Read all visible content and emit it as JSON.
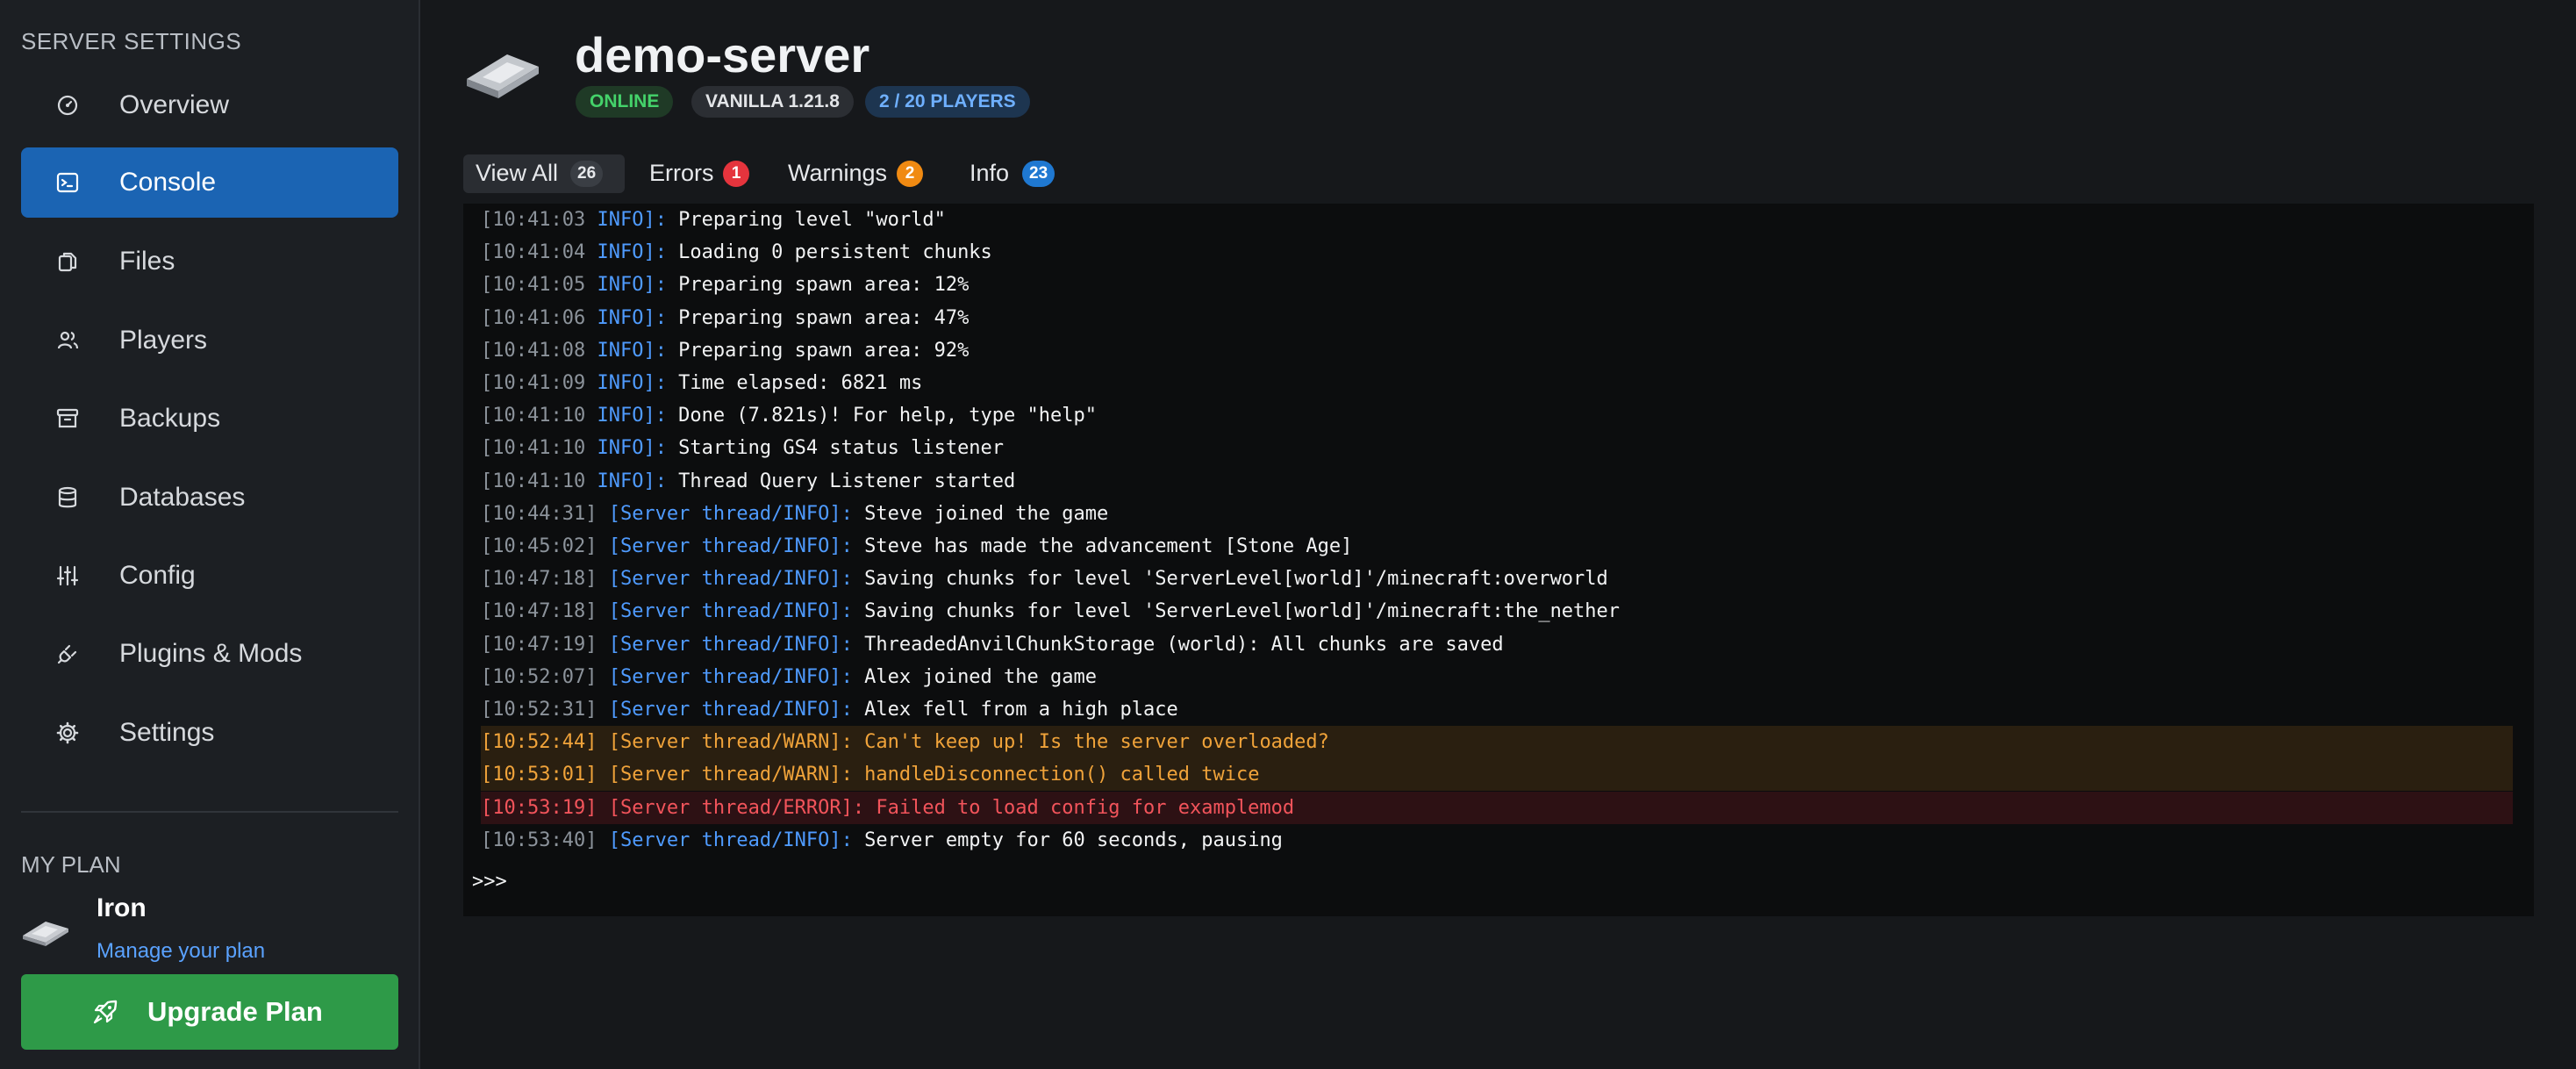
{
  "sidebar": {
    "title": "SERVER SETTINGS",
    "items": [
      {
        "label": "Overview",
        "icon": "gauge-icon"
      },
      {
        "label": "Console",
        "icon": "terminal-icon",
        "active": true
      },
      {
        "label": "Files",
        "icon": "files-icon"
      },
      {
        "label": "Players",
        "icon": "users-icon"
      },
      {
        "label": "Backups",
        "icon": "archive-icon"
      },
      {
        "label": "Databases",
        "icon": "database-icon"
      },
      {
        "label": "Config",
        "icon": "sliders-icon"
      },
      {
        "label": "Plugins & Mods",
        "icon": "plug-icon"
      },
      {
        "label": "Settings",
        "icon": "gear-icon"
      }
    ],
    "plan": {
      "title": "MY PLAN",
      "name": "Iron",
      "manage_label": "Manage your plan",
      "upgrade_label": "Upgrade Plan"
    }
  },
  "header": {
    "server_name": "demo-server",
    "status": "ONLINE",
    "version": "VANILLA 1.21.8",
    "players": "2 / 20 PLAYERS"
  },
  "tabs": [
    {
      "label": "View All",
      "count": "26"
    },
    {
      "label": "Errors",
      "count": "1"
    },
    {
      "label": "Warnings",
      "count": "2"
    },
    {
      "label": "Info",
      "count": "23"
    }
  ],
  "console": {
    "lines": [
      {
        "ts": "[10:41:03",
        "src": " INFO]:",
        "msg": " Preparing level \"world\"",
        "level": "info"
      },
      {
        "ts": "[10:41:04",
        "src": " INFO]:",
        "msg": " Loading 0 persistent chunks",
        "level": "info"
      },
      {
        "ts": "[10:41:05",
        "src": " INFO]:",
        "msg": " Preparing spawn area: 12%",
        "level": "info"
      },
      {
        "ts": "[10:41:06",
        "src": " INFO]:",
        "msg": " Preparing spawn area: 47%",
        "level": "info"
      },
      {
        "ts": "[10:41:08",
        "src": " INFO]:",
        "msg": " Preparing spawn area: 92%",
        "level": "info"
      },
      {
        "ts": "[10:41:09",
        "src": " INFO]:",
        "msg": " Time elapsed: 6821 ms",
        "level": "info"
      },
      {
        "ts": "[10:41:10",
        "src": " INFO]:",
        "msg": " Done (7.821s)! For help, type \"help\"",
        "level": "info"
      },
      {
        "ts": "[10:41:10",
        "src": " INFO]:",
        "msg": " Starting GS4 status listener",
        "level": "info"
      },
      {
        "ts": "[10:41:10",
        "src": " INFO]:",
        "msg": " Thread Query Listener started",
        "level": "info"
      },
      {
        "ts": "[10:44:31]",
        "src": " [Server thread/INFO]:",
        "msg": " Steve joined the game",
        "level": "info"
      },
      {
        "ts": "[10:45:02]",
        "src": " [Server thread/INFO]:",
        "msg": " Steve has made the advancement [Stone Age]",
        "level": "info"
      },
      {
        "ts": "[10:47:18]",
        "src": " [Server thread/INFO]:",
        "msg": " Saving chunks for level 'ServerLevel[world]'/minecraft:overworld",
        "level": "info"
      },
      {
        "ts": "[10:47:18]",
        "src": " [Server thread/INFO]:",
        "msg": " Saving chunks for level 'ServerLevel[world]'/minecraft:the_nether",
        "level": "info"
      },
      {
        "ts": "[10:47:19]",
        "src": " [Server thread/INFO]:",
        "msg": " ThreadedAnvilChunkStorage (world): All chunks are saved",
        "level": "info"
      },
      {
        "ts": "[10:52:07]",
        "src": " [Server thread/INFO]:",
        "msg": " Alex joined the game",
        "level": "info"
      },
      {
        "ts": "[10:52:31]",
        "src": " [Server thread/INFO]:",
        "msg": " Alex fell from a high place",
        "level": "info"
      },
      {
        "ts": "[10:52:44]",
        "src": " [Server thread/WARN]:",
        "msg": " Can't keep up! Is the server overloaded?",
        "level": "warn"
      },
      {
        "ts": "[10:53:01]",
        "src": " [Server thread/WARN]:",
        "msg": " handleDisconnection() called twice",
        "level": "warn"
      },
      {
        "ts": "[10:53:19]",
        "src": " [Server thread/ERROR]:",
        "msg": " Failed to load config for examplemod",
        "level": "error"
      },
      {
        "ts": "[10:53:40]",
        "src": " [Server thread/INFO]:",
        "msg": " Server empty for 60 seconds, pausing",
        "level": "info"
      }
    ],
    "prompt": ">>>"
  },
  "colors": {
    "accent": "#1b64b3",
    "upgrade": "#2e9a48",
    "error_badge": "#e5343d",
    "warning_badge": "#f08a12",
    "info_badge": "#1f78d1"
  }
}
